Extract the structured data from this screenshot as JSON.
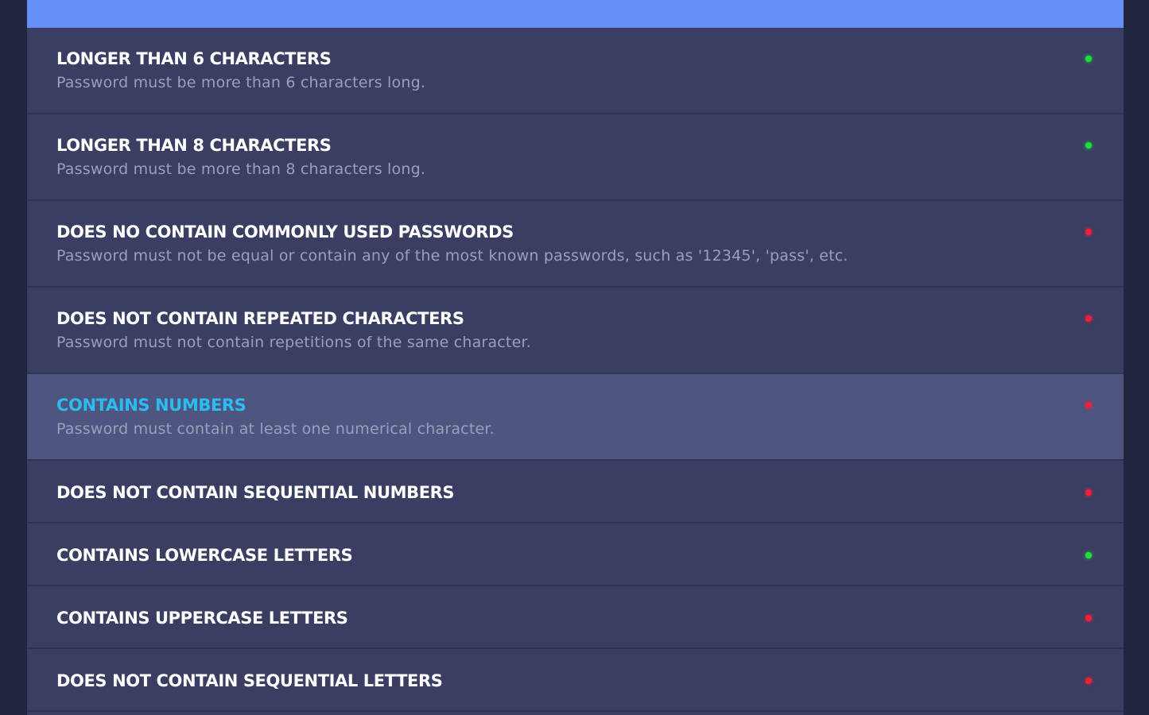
{
  "colors": {
    "pass": "#1fe03a",
    "fail": "#f0203a",
    "accent_bar": "#6490f8",
    "highlight_title": "#2bbdf0"
  },
  "rules": [
    {
      "title": "LONGER THAN 6 CHARACTERS",
      "description": "Password must be more than 6 characters long.",
      "status": "pass"
    },
    {
      "title": "LONGER THAN 8 CHARACTERS",
      "description": "Password must be more than 8 characters long.",
      "status": "pass"
    },
    {
      "title": "DOES NO CONTAIN COMMONLY USED PASSWORDS",
      "description": "Password must not be equal or contain any of the most known passwords, such as '12345', 'pass', etc.",
      "status": "fail"
    },
    {
      "title": "DOES NOT CONTAIN REPEATED CHARACTERS",
      "description": "Password must not contain repetitions of the same character.",
      "status": "fail"
    },
    {
      "title": "CONTAINS NUMBERS",
      "description": "Password must contain at least one numerical character.",
      "status": "fail",
      "highlighted": true
    },
    {
      "title": "DOES NOT CONTAIN SEQUENTIAL NUMBERS",
      "status": "fail"
    },
    {
      "title": "CONTAINS LOWERCASE LETTERS",
      "status": "pass"
    },
    {
      "title": "CONTAINS UPPERCASE LETTERS",
      "status": "fail"
    },
    {
      "title": "DOES NOT CONTAIN SEQUENTIAL LETTERS",
      "status": "fail"
    }
  ]
}
